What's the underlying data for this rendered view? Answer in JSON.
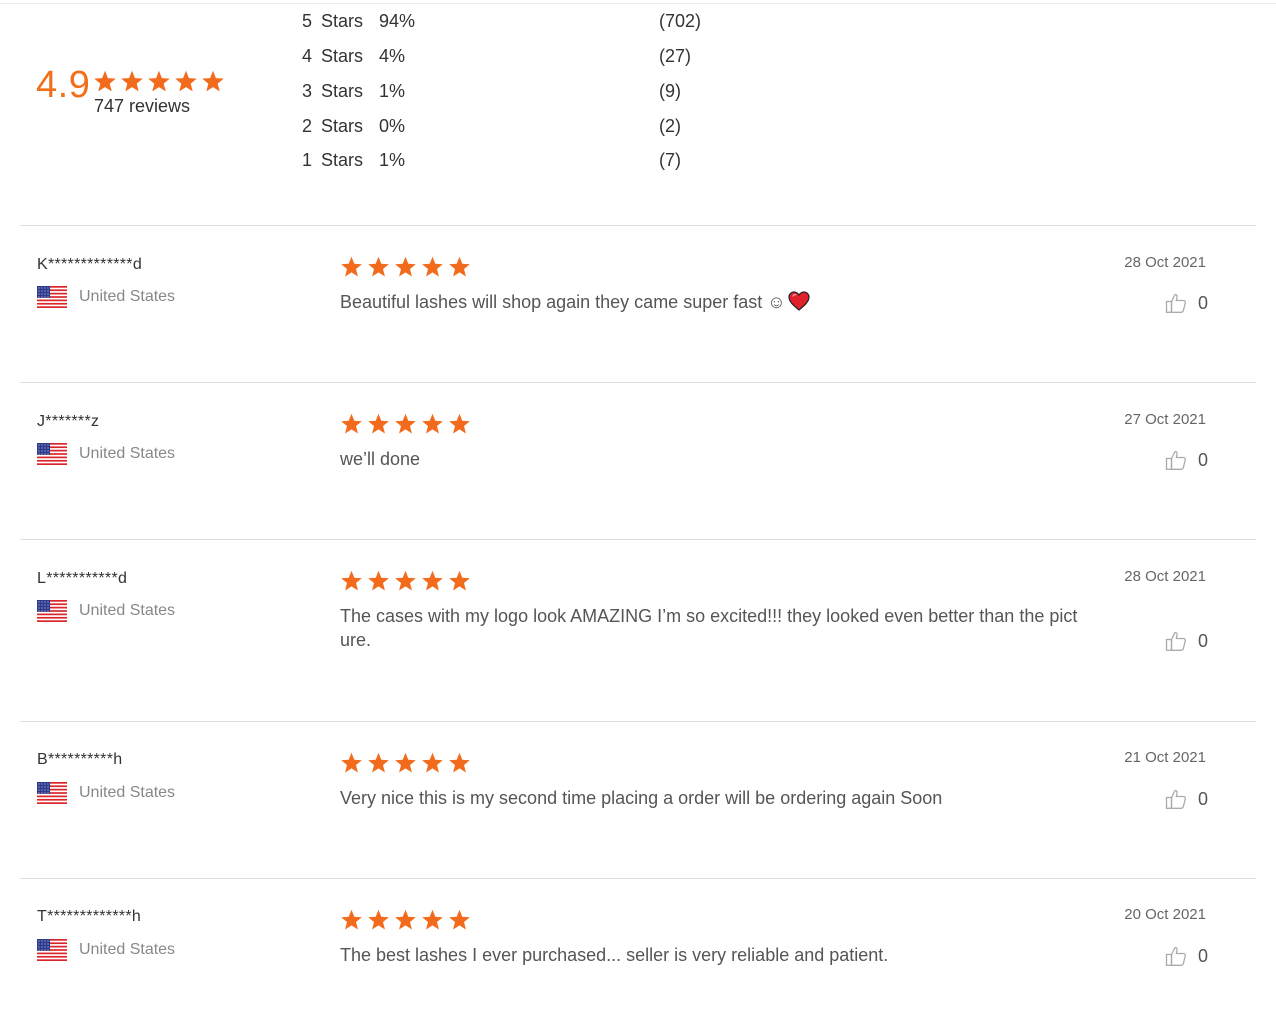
{
  "summary": {
    "average": "4.9",
    "average_stars": 5,
    "review_count_label": "747 reviews",
    "distribution": [
      {
        "num": "5",
        "label": "Stars",
        "percent": "94%",
        "count": "(702)"
      },
      {
        "num": "4",
        "label": "Stars",
        "percent": "4%",
        "count": "(27)"
      },
      {
        "num": "3",
        "label": "Stars",
        "percent": "1%",
        "count": "(9)"
      },
      {
        "num": "2",
        "label": "Stars",
        "percent": "0%",
        "count": "(2)"
      },
      {
        "num": "1",
        "label": "Stars",
        "percent": "1%",
        "count": "(7)"
      }
    ]
  },
  "colors": {
    "accent": "#f2701b",
    "star": "#f26b1d",
    "divider": "#dddddd",
    "muted_text": "#888888"
  },
  "icons": {
    "star": "star-icon",
    "flag": "us-flag-icon",
    "like": "thumbs-up-icon",
    "heart": "heart-icon"
  },
  "reviews": [
    {
      "name": "K*************d",
      "country": "United States",
      "rating": 5,
      "text": "Beautiful lashes will shop again they came super fast ☺",
      "emoji": "heart",
      "date": "28 Oct 2021",
      "likes": "0"
    },
    {
      "name": "J*******z",
      "country": "United States",
      "rating": 5,
      "text": "we’ll done",
      "emoji": "",
      "date": "27 Oct 2021",
      "likes": "0"
    },
    {
      "name": "L***********d",
      "country": "United States",
      "rating": 5,
      "text": "The cases with my logo look AMAZING I’m so excited!!! they looked even better than the picture.",
      "emoji": "",
      "date": "28 Oct 2021",
      "likes": "0"
    },
    {
      "name": "B**********h",
      "country": "United States",
      "rating": 5,
      "text": "Very nice this is my second time placing a order will be ordering again Soon",
      "emoji": "",
      "date": "21 Oct 2021",
      "likes": "0"
    },
    {
      "name": "T*************h",
      "country": "United States",
      "rating": 5,
      "text": "The best lashes I ever purchased... seller is very reliable and patient.",
      "emoji": "",
      "date": "20 Oct 2021",
      "likes": "0"
    }
  ]
}
